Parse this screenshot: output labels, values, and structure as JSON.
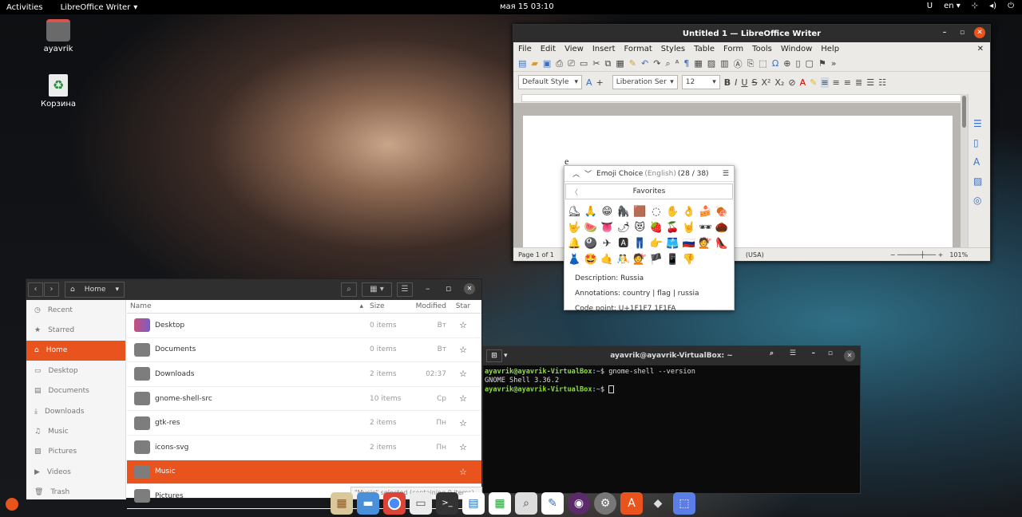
{
  "topbar": {
    "activities": "Activities",
    "app": "LibreOffice Writer",
    "clock": "мая 15 03:10",
    "lang": "en"
  },
  "desktop": {
    "home_label": "ayavrik",
    "trash_label": "Корзина"
  },
  "writer": {
    "title": "Untitled 1 — LibreOffice Writer",
    "menu": [
      "File",
      "Edit",
      "View",
      "Insert",
      "Format",
      "Styles",
      "Table",
      "Form",
      "Tools",
      "Window",
      "Help"
    ],
    "para_style": "Default Style",
    "font_name": "Liberation Ser",
    "font_size": "12",
    "status_page": "Page 1 of 1",
    "status_lang": "(USA)",
    "zoom": "101%",
    "doc_char": "e"
  },
  "emoji": {
    "title": "Emoji Choice",
    "lang": "(English)",
    "count": "(28 / 38)",
    "category": "Favorites",
    "rows": [
      [
        "⛸",
        "🙏",
        "😁",
        "🦍",
        "🟫",
        "◌",
        "✋",
        "👌",
        "🍰",
        "🍖"
      ],
      [
        "🤟",
        "🍉",
        "👅",
        "🌶",
        "😻",
        "🍓",
        "🍒",
        "🤘",
        "🕶",
        "🌰"
      ],
      [
        "🔔",
        "🎱",
        "✈",
        "🅰",
        "👖",
        "👉",
        "🩳",
        "🇷🇺",
        "💇",
        "👠"
      ],
      [
        "👗",
        "🤩",
        "🤙",
        "🤼",
        "💇",
        "🏴",
        "📱",
        "👎",
        "",
        ""
      ]
    ],
    "description": "Description: Russia",
    "annotations": "Annotations: country | flag | russia",
    "codepoint": "Code point: U+1F1F7 1F1FA"
  },
  "files": {
    "path": "Home",
    "sidebar": [
      "Recent",
      "Starred",
      "Home",
      "Desktop",
      "Documents",
      "Downloads",
      "Music",
      "Pictures",
      "Videos",
      "Trash"
    ],
    "columns": {
      "name": "Name",
      "size": "Size",
      "modified": "Modified",
      "star": "Star"
    },
    "rows": [
      {
        "name": "Desktop",
        "size": "0 items",
        "mod": "Вт"
      },
      {
        "name": "Documents",
        "size": "0 items",
        "mod": "Вт"
      },
      {
        "name": "Downloads",
        "size": "2 items",
        "mod": "02:37"
      },
      {
        "name": "gnome-shell-src",
        "size": "10 items",
        "mod": "Ср"
      },
      {
        "name": "gtk-res",
        "size": "2 items",
        "mod": "Пн"
      },
      {
        "name": "icons-svg",
        "size": "2 items",
        "mod": "Пн"
      },
      {
        "name": "Music",
        "size": "",
        "mod": ""
      },
      {
        "name": "Pictures",
        "size": "",
        "mod": ""
      }
    ],
    "selection_status": "\"Music\" selected (containing 0 items)"
  },
  "terminal": {
    "title": "ayavrik@ayavrik-VirtualBox: ~",
    "prompt_user": "ayavrik@ayavrik-VirtualBox",
    "prompt_path": ":~",
    "cmd": "$ gnome-shell --version",
    "output": "GNOME Shell 3.36.2",
    "cursor_line": "$ "
  }
}
